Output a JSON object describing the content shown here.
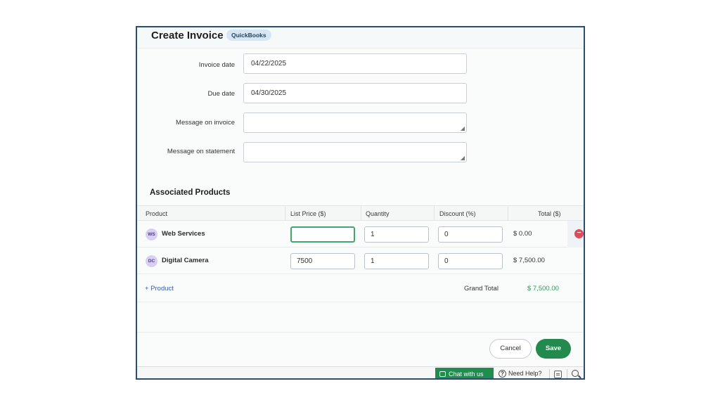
{
  "header": {
    "title": "Create Invoice",
    "badge": "QuickBooks"
  },
  "form": {
    "invoice_date": {
      "label": "Invoice date",
      "value": "04/22/2025"
    },
    "due_date": {
      "label": "Due date",
      "value": "04/30/2025"
    },
    "message_invoice": {
      "label": "Message on invoice",
      "value": ""
    },
    "message_statement": {
      "label": "Message on statement",
      "value": ""
    }
  },
  "products": {
    "section_title": "Associated Products",
    "columns": [
      "Product",
      "List Price ($)",
      "Quantity",
      "Discount (%)",
      "Total ($)"
    ],
    "rows": [
      {
        "initials": "WS",
        "name": "Web Services",
        "list_price": "",
        "quantity": "1",
        "discount": "0",
        "total": "$ 0.00"
      },
      {
        "initials": "DC",
        "name": "Digital Camera",
        "list_price": "7500",
        "quantity": "1",
        "discount": "0",
        "total": "$ 7,500.00"
      }
    ],
    "add_label": "+ Product",
    "grand_total_label": "Grand Total",
    "grand_total_value": "$ 7,500.00"
  },
  "actions": {
    "cancel": "Cancel",
    "save": "Save"
  },
  "bottom_bar": {
    "chat": "Chat with us",
    "help": "Need Help?"
  },
  "colors": {
    "accent_green": "#228a4c",
    "frame_border": "#2a4d73",
    "link_blue": "#2d5fb5",
    "remove_red": "#e04b5a"
  }
}
